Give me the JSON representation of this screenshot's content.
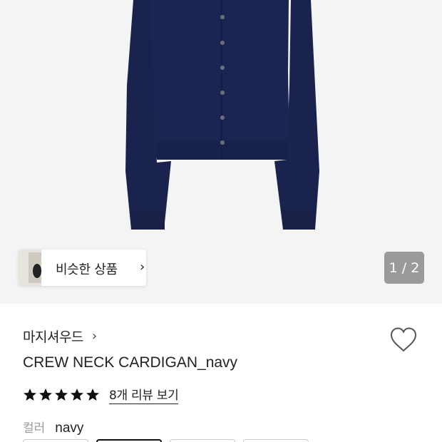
{
  "gallery": {
    "similar_products_label": "비슷한 상품",
    "page_indicator": "1 / 2",
    "product_color": "#1b2551"
  },
  "product": {
    "brand": "마지셔우드",
    "name": "CREW NECK CARDIGAN_navy",
    "rating": 5,
    "review_link": "8개 리뷰 보기",
    "option_label": "컬러",
    "option_value": "navy"
  },
  "icons": {
    "wishlist": "heart-outline-icon",
    "chevron": "chevron-right-icon",
    "star": "star-filled-icon"
  }
}
